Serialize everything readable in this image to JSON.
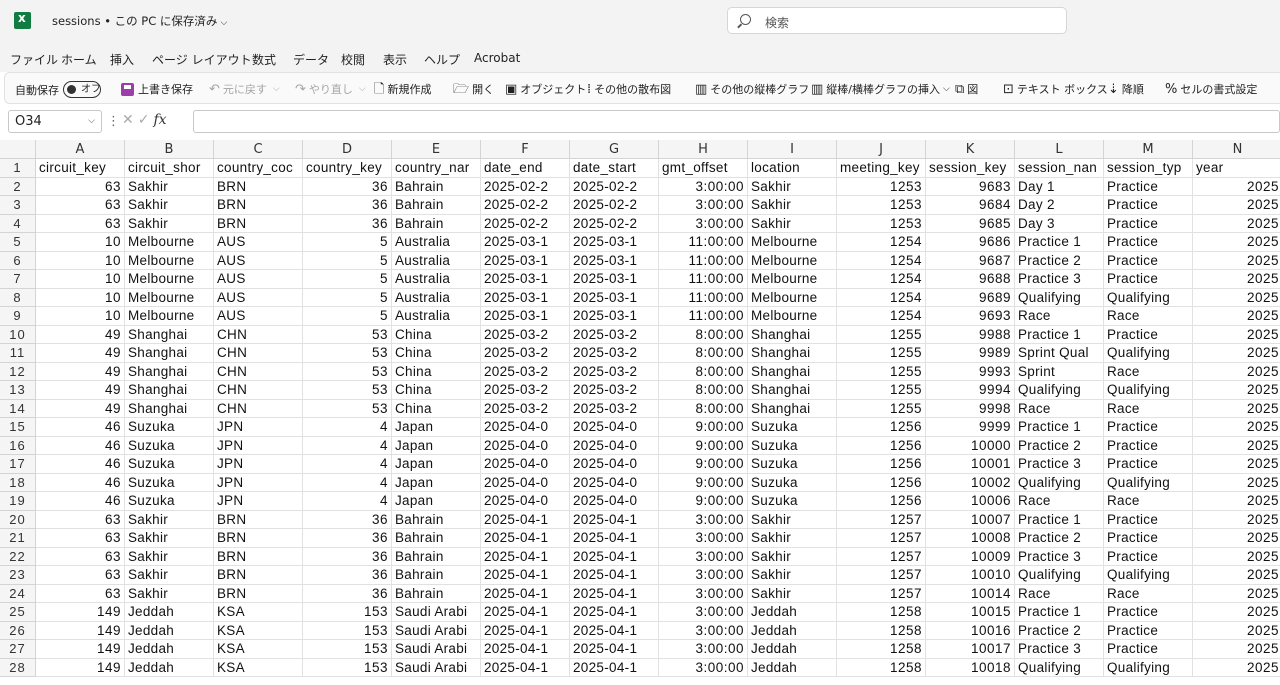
{
  "app": {
    "title": "sessions • この PC に保存済み",
    "search_placeholder": "検索",
    "brand_color": "#107c41"
  },
  "menu": [
    "ファイル",
    "ホーム",
    "挿入",
    "ページ レイアウト",
    "数式",
    "データ",
    "校閲",
    "表示",
    "ヘルプ",
    "Acrobat"
  ],
  "ribbon": {
    "autosave_label": "自動保存",
    "autosave_state": "オフ",
    "save_label": "上書き保存",
    "undo_label": "元に戻す",
    "redo_label": "やり直し",
    "new_label": "新規作成",
    "open_label": "開く",
    "object_label": "オブジェクト",
    "scatter_label": "その他の散布図",
    "column_label": "その他の縦棒グラフ",
    "insert_chart_label": "縦棒/横棒グラフの挿入",
    "figure_label": "図",
    "textbox_label": "テキスト ボックス",
    "sort_desc_label": "降順",
    "format_cells_label": "セルの書式設定"
  },
  "formula_bar": {
    "name_box": "O34",
    "fx": "fx",
    "content": ""
  },
  "sheet": {
    "col_letters": [
      "A",
      "B",
      "C",
      "D",
      "E",
      "F",
      "G",
      "H",
      "I",
      "J",
      "K",
      "L",
      "M",
      "N"
    ],
    "row_numbers": [
      "1",
      "2",
      "3",
      "4",
      "5",
      "6",
      "7",
      "8",
      "9",
      "10",
      "11",
      "12",
      "13",
      "14",
      "15",
      "16",
      "17",
      "18",
      "19",
      "20",
      "21",
      "22",
      "23",
      "24",
      "25",
      "26",
      "27",
      "28"
    ],
    "header": [
      "circuit_key",
      "circuit_shor",
      "country_coc",
      "country_key",
      "country_nar",
      "date_end",
      "date_start",
      "gmt_offset",
      "location",
      "meeting_key",
      "session_key",
      "session_nan",
      "session_typ",
      "year"
    ],
    "rows": [
      [
        "63",
        "Sakhir",
        "BRN",
        "36",
        "Bahrain",
        "2025-02-2",
        "2025-02-2",
        "3:00:00",
        "Sakhir",
        "1253",
        "9683",
        "Day 1",
        "Practice",
        "2025"
      ],
      [
        "63",
        "Sakhir",
        "BRN",
        "36",
        "Bahrain",
        "2025-02-2",
        "2025-02-2",
        "3:00:00",
        "Sakhir",
        "1253",
        "9684",
        "Day 2",
        "Practice",
        "2025"
      ],
      [
        "63",
        "Sakhir",
        "BRN",
        "36",
        "Bahrain",
        "2025-02-2",
        "2025-02-2",
        "3:00:00",
        "Sakhir",
        "1253",
        "9685",
        "Day 3",
        "Practice",
        "2025"
      ],
      [
        "10",
        "Melbourne",
        "AUS",
        "5",
        "Australia",
        "2025-03-1",
        "2025-03-1",
        "11:00:00",
        "Melbourne",
        "1254",
        "9686",
        "Practice 1",
        "Practice",
        "2025"
      ],
      [
        "10",
        "Melbourne",
        "AUS",
        "5",
        "Australia",
        "2025-03-1",
        "2025-03-1",
        "11:00:00",
        "Melbourne",
        "1254",
        "9687",
        "Practice 2",
        "Practice",
        "2025"
      ],
      [
        "10",
        "Melbourne",
        "AUS",
        "5",
        "Australia",
        "2025-03-1",
        "2025-03-1",
        "11:00:00",
        "Melbourne",
        "1254",
        "9688",
        "Practice 3",
        "Practice",
        "2025"
      ],
      [
        "10",
        "Melbourne",
        "AUS",
        "5",
        "Australia",
        "2025-03-1",
        "2025-03-1",
        "11:00:00",
        "Melbourne",
        "1254",
        "9689",
        "Qualifying",
        "Qualifying",
        "2025"
      ],
      [
        "10",
        "Melbourne",
        "AUS",
        "5",
        "Australia",
        "2025-03-1",
        "2025-03-1",
        "11:00:00",
        "Melbourne",
        "1254",
        "9693",
        "Race",
        "Race",
        "2025"
      ],
      [
        "49",
        "Shanghai",
        "CHN",
        "53",
        "China",
        "2025-03-2",
        "2025-03-2",
        "8:00:00",
        "Shanghai",
        "1255",
        "9988",
        "Practice 1",
        "Practice",
        "2025"
      ],
      [
        "49",
        "Shanghai",
        "CHN",
        "53",
        "China",
        "2025-03-2",
        "2025-03-2",
        "8:00:00",
        "Shanghai",
        "1255",
        "9989",
        "Sprint Qual",
        "Qualifying",
        "2025"
      ],
      [
        "49",
        "Shanghai",
        "CHN",
        "53",
        "China",
        "2025-03-2",
        "2025-03-2",
        "8:00:00",
        "Shanghai",
        "1255",
        "9993",
        "Sprint",
        "Race",
        "2025"
      ],
      [
        "49",
        "Shanghai",
        "CHN",
        "53",
        "China",
        "2025-03-2",
        "2025-03-2",
        "8:00:00",
        "Shanghai",
        "1255",
        "9994",
        "Qualifying",
        "Qualifying",
        "2025"
      ],
      [
        "49",
        "Shanghai",
        "CHN",
        "53",
        "China",
        "2025-03-2",
        "2025-03-2",
        "8:00:00",
        "Shanghai",
        "1255",
        "9998",
        "Race",
        "Race",
        "2025"
      ],
      [
        "46",
        "Suzuka",
        "JPN",
        "4",
        "Japan",
        "2025-04-0",
        "2025-04-0",
        "9:00:00",
        "Suzuka",
        "1256",
        "9999",
        "Practice 1",
        "Practice",
        "2025"
      ],
      [
        "46",
        "Suzuka",
        "JPN",
        "4",
        "Japan",
        "2025-04-0",
        "2025-04-0",
        "9:00:00",
        "Suzuka",
        "1256",
        "10000",
        "Practice 2",
        "Practice",
        "2025"
      ],
      [
        "46",
        "Suzuka",
        "JPN",
        "4",
        "Japan",
        "2025-04-0",
        "2025-04-0",
        "9:00:00",
        "Suzuka",
        "1256",
        "10001",
        "Practice 3",
        "Practice",
        "2025"
      ],
      [
        "46",
        "Suzuka",
        "JPN",
        "4",
        "Japan",
        "2025-04-0",
        "2025-04-0",
        "9:00:00",
        "Suzuka",
        "1256",
        "10002",
        "Qualifying",
        "Qualifying",
        "2025"
      ],
      [
        "46",
        "Suzuka",
        "JPN",
        "4",
        "Japan",
        "2025-04-0",
        "2025-04-0",
        "9:00:00",
        "Suzuka",
        "1256",
        "10006",
        "Race",
        "Race",
        "2025"
      ],
      [
        "63",
        "Sakhir",
        "BRN",
        "36",
        "Bahrain",
        "2025-04-1",
        "2025-04-1",
        "3:00:00",
        "Sakhir",
        "1257",
        "10007",
        "Practice 1",
        "Practice",
        "2025"
      ],
      [
        "63",
        "Sakhir",
        "BRN",
        "36",
        "Bahrain",
        "2025-04-1",
        "2025-04-1",
        "3:00:00",
        "Sakhir",
        "1257",
        "10008",
        "Practice 2",
        "Practice",
        "2025"
      ],
      [
        "63",
        "Sakhir",
        "BRN",
        "36",
        "Bahrain",
        "2025-04-1",
        "2025-04-1",
        "3:00:00",
        "Sakhir",
        "1257",
        "10009",
        "Practice 3",
        "Practice",
        "2025"
      ],
      [
        "63",
        "Sakhir",
        "BRN",
        "36",
        "Bahrain",
        "2025-04-1",
        "2025-04-1",
        "3:00:00",
        "Sakhir",
        "1257",
        "10010",
        "Qualifying",
        "Qualifying",
        "2025"
      ],
      [
        "63",
        "Sakhir",
        "BRN",
        "36",
        "Bahrain",
        "2025-04-1",
        "2025-04-1",
        "3:00:00",
        "Sakhir",
        "1257",
        "10014",
        "Race",
        "Race",
        "2025"
      ],
      [
        "149",
        "Jeddah",
        "KSA",
        "153",
        "Saudi Arabi",
        "2025-04-1",
        "2025-04-1",
        "3:00:00",
        "Jeddah",
        "1258",
        "10015",
        "Practice 1",
        "Practice",
        "2025"
      ],
      [
        "149",
        "Jeddah",
        "KSA",
        "153",
        "Saudi Arabi",
        "2025-04-1",
        "2025-04-1",
        "3:00:00",
        "Jeddah",
        "1258",
        "10016",
        "Practice 2",
        "Practice",
        "2025"
      ],
      [
        "149",
        "Jeddah",
        "KSA",
        "153",
        "Saudi Arabi",
        "2025-04-1",
        "2025-04-1",
        "3:00:00",
        "Jeddah",
        "1258",
        "10017",
        "Practice 3",
        "Practice",
        "2025"
      ],
      [
        "149",
        "Jeddah",
        "KSA",
        "153",
        "Saudi Arabi",
        "2025-04-1",
        "2025-04-1",
        "3:00:00",
        "Jeddah",
        "1258",
        "10018",
        "Qualifying",
        "Qualifying",
        "2025"
      ]
    ]
  }
}
